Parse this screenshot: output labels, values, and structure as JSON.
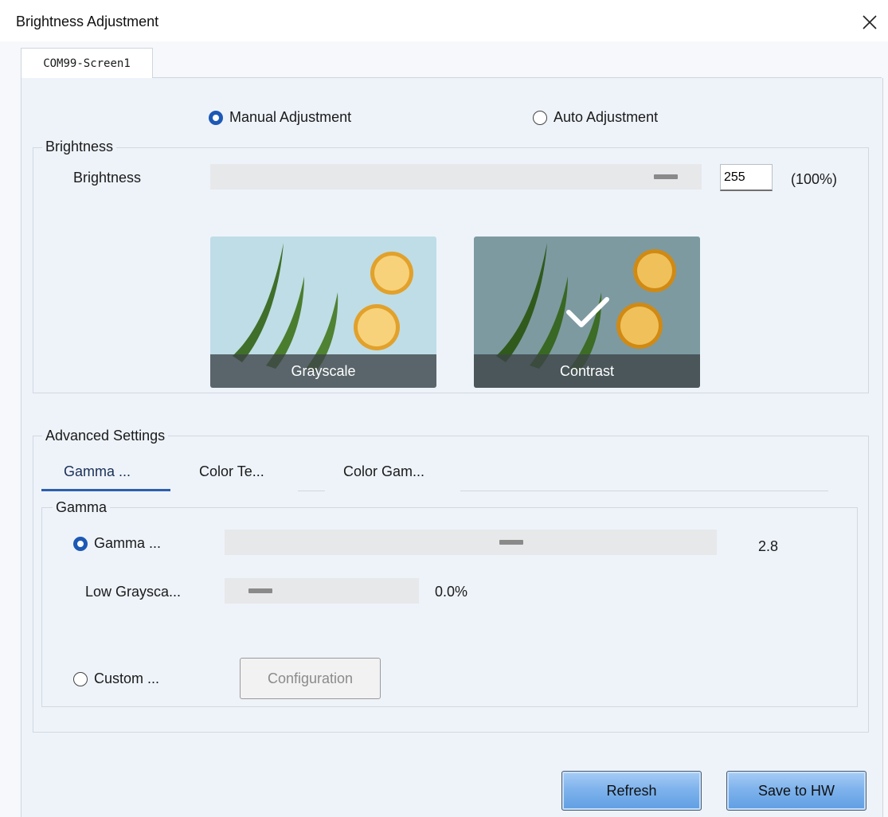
{
  "window": {
    "title": "Brightness Adjustment",
    "close_icon": "close-icon"
  },
  "screen_tab": {
    "label": "COM99-Screen1"
  },
  "mode": {
    "manual_label": "Manual Adjustment",
    "auto_label": "Auto Adjustment",
    "selected": "manual"
  },
  "brightness": {
    "group_title": "Brightness",
    "label": "Brightness",
    "slider_fraction": 1.0,
    "value": "255",
    "percent": "(100%)"
  },
  "presets": [
    {
      "label": "Grayscale",
      "selected": false
    },
    {
      "label": "Contrast",
      "selected": true
    }
  ],
  "advanced": {
    "group_title": "Advanced Settings",
    "tabs": [
      {
        "label": "Gamma ...",
        "active": true
      },
      {
        "label": "Color Te...",
        "active": false
      },
      {
        "label": "Color Gam...",
        "active": false
      }
    ],
    "gamma": {
      "group_title": "Gamma",
      "gamma_option_label": "Gamma ...",
      "gamma_value": "2.8",
      "low_grayscale_label": "Low Graysca...",
      "low_grayscale_value": "0.0%",
      "custom_option_label": "Custom ...",
      "configuration_label": "Configuration",
      "selected": "gamma"
    }
  },
  "footer": {
    "refresh_label": "Refresh",
    "save_label": "Save to HW"
  },
  "colors": {
    "accent": "#1d59b5",
    "tab_underline": "#2c5fae",
    "button_blue": "#7fb3ec"
  }
}
